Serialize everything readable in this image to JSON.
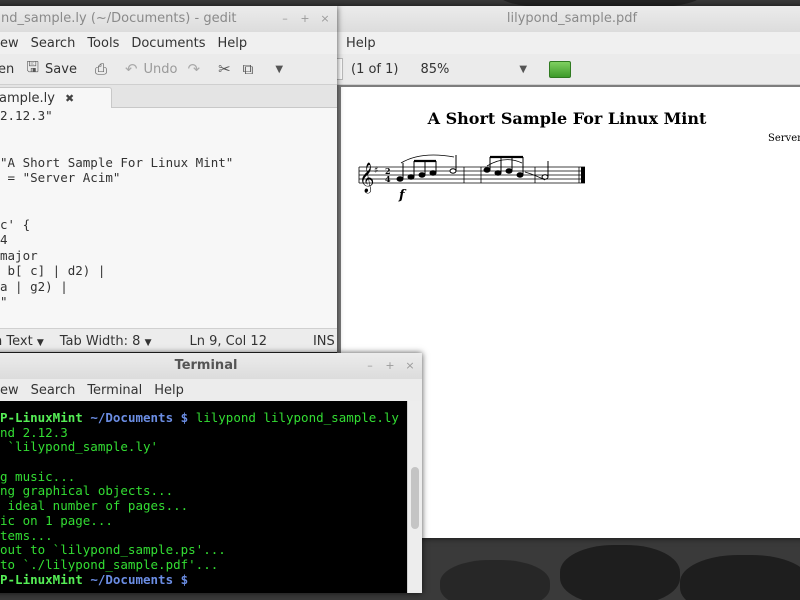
{
  "gedit": {
    "title": "nd_sample.ly (~/Documents) - gedit",
    "menu": [
      "ew",
      "Search",
      "Tools",
      "Documents",
      "Help"
    ],
    "toolbar": {
      "open": "en",
      "save": "Save",
      "undo": "Undo"
    },
    "tab_label": "ample.ly",
    "lines": [
      "2.12.3\"",
      "",
      "",
      "\"A Short Sample For Linux Mint\"",
      " = \"Server Acim\"",
      "",
      "",
      "c' {",
      "4",
      "major",
      " b[ c] | d2) |",
      "a | g2) |",
      "\""
    ],
    "status": {
      "lang": "n Text",
      "tabwidth": "Tab Width:  8",
      "position": "Ln 9, Col 12",
      "mode": "INS"
    }
  },
  "evince": {
    "title": "lilypond_sample.pdf",
    "menu": [
      "Help"
    ],
    "page_indicator": "(1 of 1)",
    "zoom": "85%",
    "doc_title": "A Short Sample For Linux Mint",
    "doc_composer": "Server A",
    "dynamic": "f"
  },
  "terminal": {
    "title": "Terminal",
    "menu": [
      "ew",
      "Search",
      "Terminal",
      "Help"
    ],
    "prompt_user": "P-LinuxMint",
    "prompt_dir": "~/Documents $",
    "command": "lilypond lilypond_sample.ly",
    "output": [
      "nd 2.12.3",
      " `lilypond_sample.ly'",
      "",
      "g music...",
      "ng graphical objects...",
      " ideal number of pages...",
      "ic on 1 page...",
      "tems...",
      "out to `lilypond_sample.ps'...",
      "to `./lilypond_sample.pdf'..."
    ]
  },
  "colors": {
    "terminal_text": "#33dd33",
    "prompt_dir": "#6b8de3",
    "desktop": "#3a3a3a"
  }
}
